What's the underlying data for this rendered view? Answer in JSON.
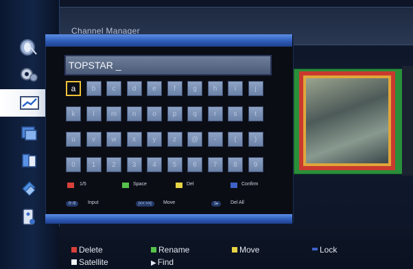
{
  "header": {
    "title": "Channel Manager"
  },
  "sidebar": {
    "items": [
      {
        "icon": "satellite-dish-icon"
      },
      {
        "icon": "gear-icon"
      },
      {
        "icon": "chart-icon"
      },
      {
        "icon": "media-icon"
      },
      {
        "icon": "phone-icon"
      },
      {
        "icon": "tools-icon"
      },
      {
        "icon": "remote-icon"
      }
    ],
    "selected_index": 2
  },
  "dialog": {
    "input_value": "TOPSTAR _",
    "selected_key": "a",
    "keys": [
      [
        "a",
        "b",
        "c",
        "d",
        "e",
        "f",
        "g",
        "h",
        "i",
        "j"
      ],
      [
        "k",
        "l",
        "m",
        "n",
        "o",
        "p",
        "q",
        "r",
        "s",
        "t"
      ],
      [
        "u",
        "v",
        "w",
        "x",
        "y",
        "z",
        "@",
        "-",
        "(",
        ")"
      ],
      [
        "0",
        "1",
        "2",
        "3",
        "4",
        "5",
        "6",
        "7",
        "8",
        "9"
      ]
    ],
    "legend": {
      "red_label": "1/5",
      "green_label": "Space",
      "yellow_label": "Del",
      "blue_label": "Confirm",
      "btn_input": "0~9",
      "input_label": "Input",
      "btn_move": "|<< >>|",
      "move_label": "Move",
      "btn_delall": "1▸",
      "delall_label": "Del All"
    }
  },
  "footer": {
    "delete": "Delete",
    "rename": "Rename",
    "move": "Move",
    "lock": "Lock",
    "satellite": "Satellite",
    "find": "Find"
  },
  "colors": {
    "red": "#d8403a",
    "green": "#55c24a",
    "yellow": "#e6d445",
    "blue": "#3f62c7",
    "selection": "#f2c437"
  }
}
